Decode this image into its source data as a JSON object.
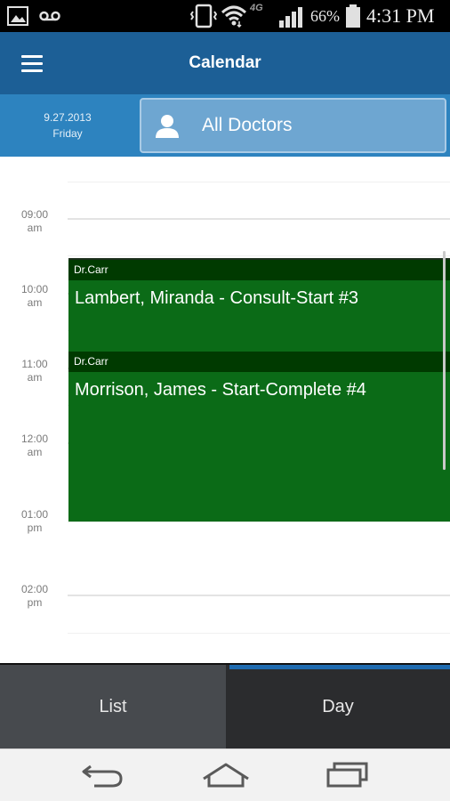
{
  "status_bar": {
    "network": "4G",
    "battery": "66%",
    "time": "4:31 PM",
    "icons": [
      "gallery-icon",
      "voicemail-icon",
      "vibrate-icon",
      "wifi-icon",
      "signal-icon",
      "battery-icon"
    ]
  },
  "app_bar": {
    "title": "Calendar",
    "menu_icon": "hamburger-menu-icon"
  },
  "date_header": {
    "date": "9.27.2013",
    "weekday": "Friday"
  },
  "doctor_filter": {
    "label": "All Doctors",
    "icon": "person-icon"
  },
  "timeline": {
    "hours": [
      {
        "time": "09:00",
        "period": "am"
      },
      {
        "time": "10:00",
        "period": "am"
      },
      {
        "time": "11:00",
        "period": "am"
      },
      {
        "time": "12:00",
        "period": "am"
      },
      {
        "time": "01:00",
        "period": "pm"
      },
      {
        "time": "02:00",
        "period": "pm"
      }
    ]
  },
  "events": [
    {
      "doctor": "Dr.Carr",
      "title": "Lambert, Miranda - Consult-Start #3"
    },
    {
      "doctor": "Dr.Carr",
      "title": "Morrison, James - Start-Complete #4"
    }
  ],
  "tabs": [
    {
      "label": "List",
      "selected": false
    },
    {
      "label": "Day",
      "selected": true
    }
  ],
  "nav_bar": {
    "icons": [
      "back-icon",
      "home-icon",
      "recent-apps-icon"
    ]
  },
  "colors": {
    "app_bar": "#1c5f96",
    "sub_header": "#2d83bf",
    "event_bg": "#0b6b17",
    "event_header": "#003a00",
    "tab_indicator": "#1f6bb0"
  }
}
